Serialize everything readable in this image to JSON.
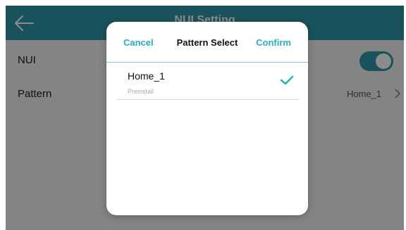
{
  "appbar": {
    "title": "NUI Setting"
  },
  "settings": [
    {
      "label": "NUI",
      "toggle_on": true
    },
    {
      "label": "Pattern",
      "value": "Home_1"
    }
  ],
  "dialog": {
    "cancel_label": "Cancel",
    "title": "Pattern Select",
    "confirm_label": "Confirm",
    "options": [
      {
        "name": "Home_1",
        "subtitle": "Preinstall",
        "selected": true
      }
    ]
  },
  "colors": {
    "accent": "#2f95a6",
    "dialog_accent": "#26aec0"
  },
  "icons": {
    "back": "back-arrow-icon",
    "chevron": "chevron-right-icon",
    "check": "checkmark-icon"
  }
}
